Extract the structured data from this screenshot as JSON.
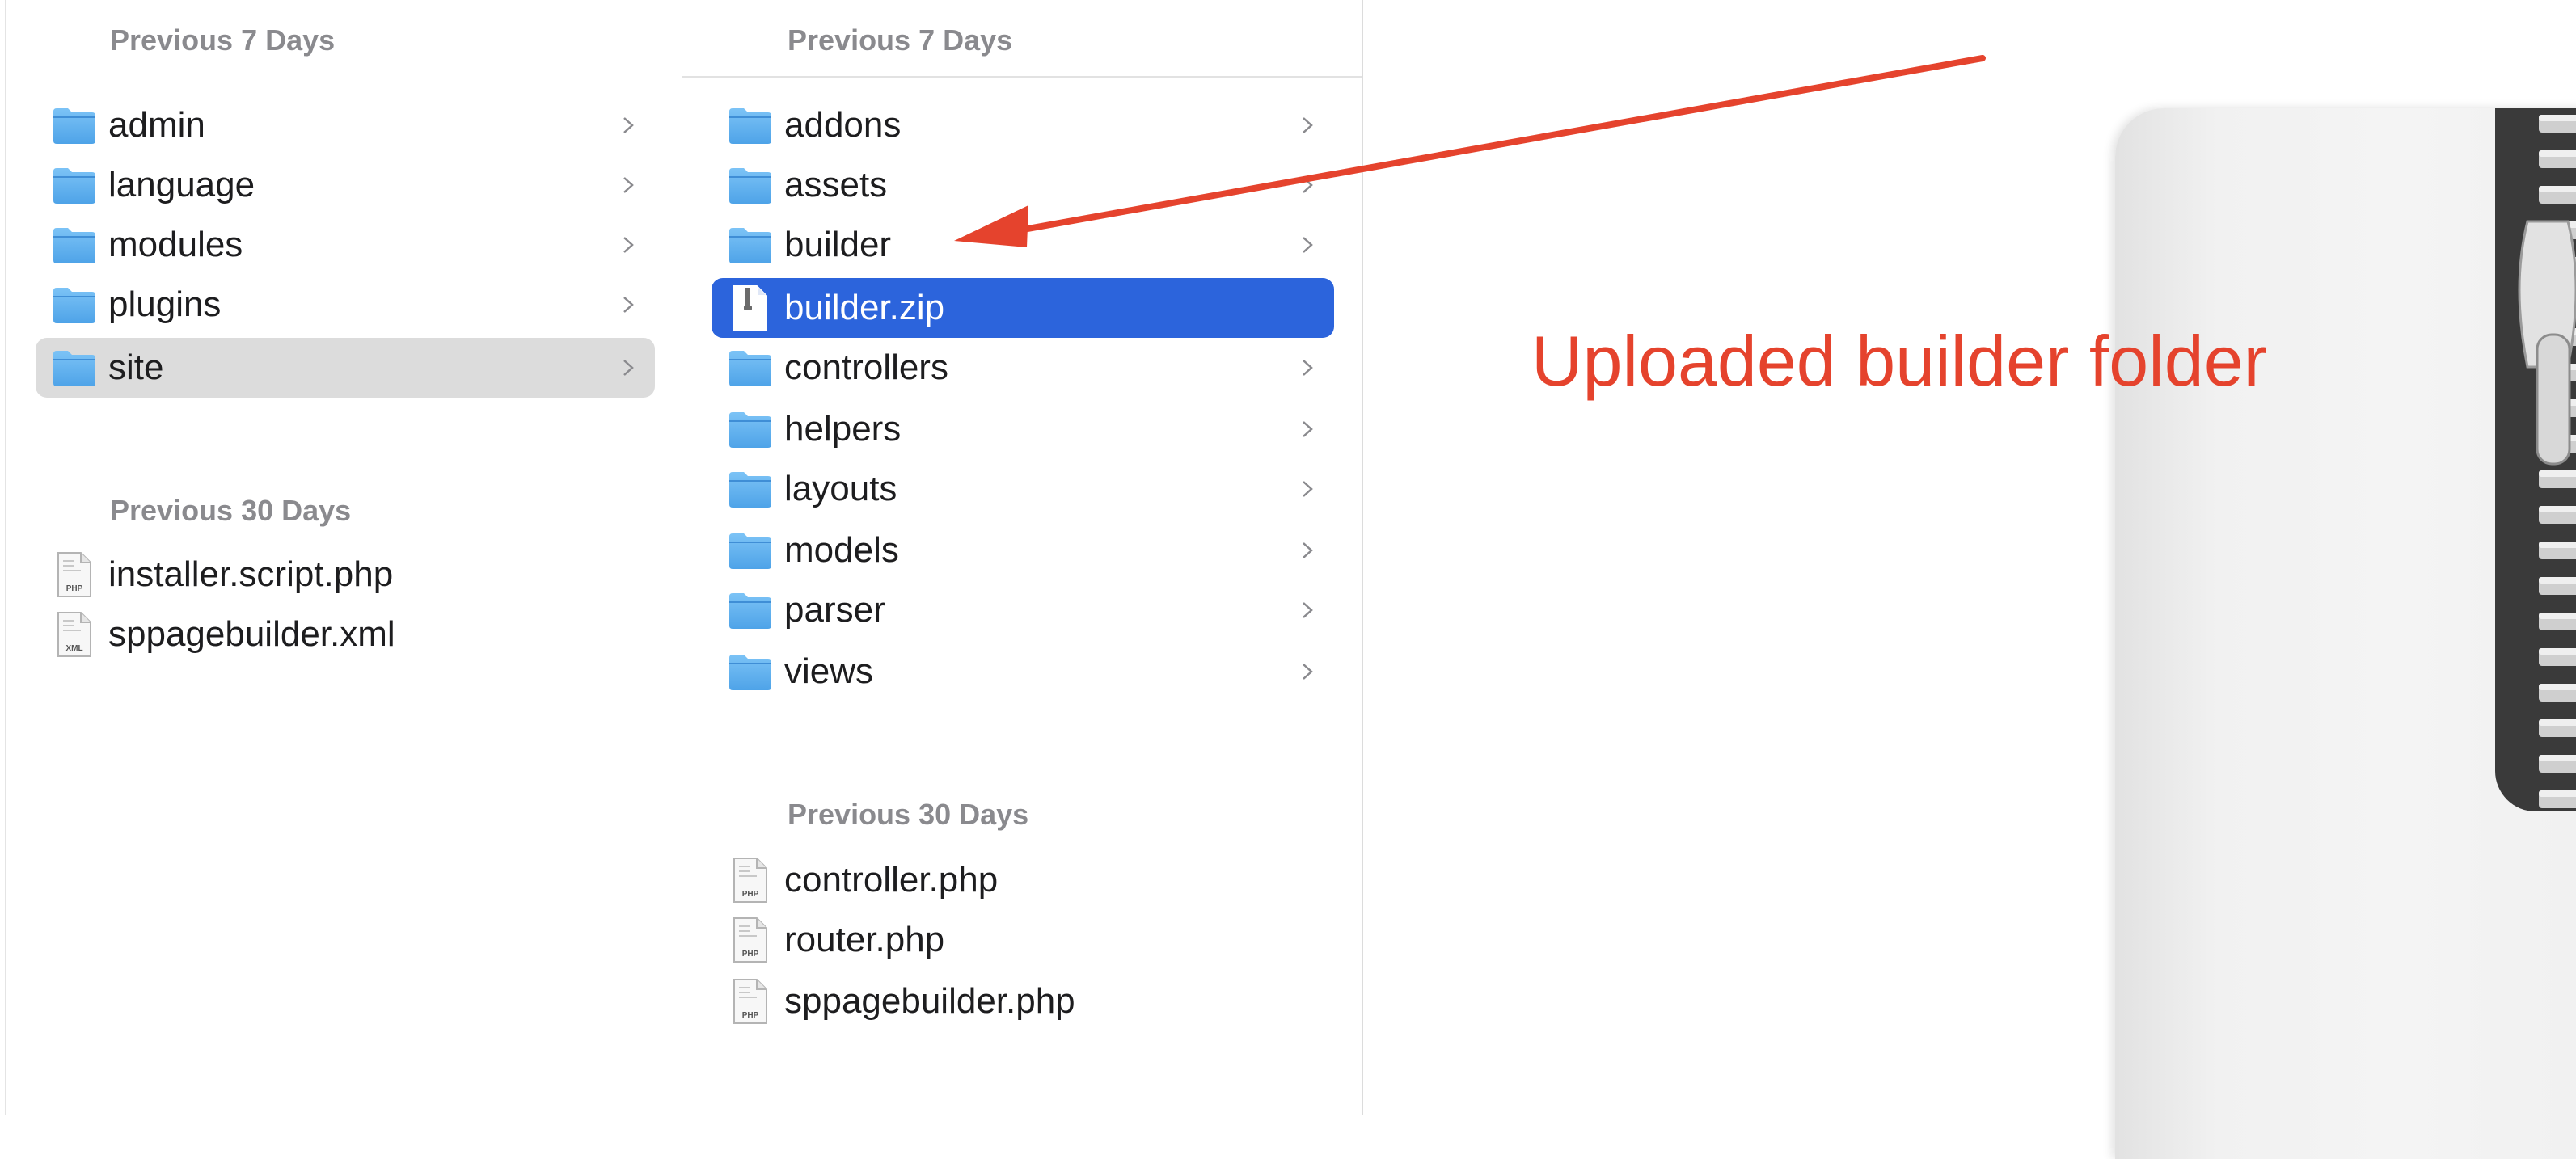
{
  "col1": {
    "section_recent": "Previous 7 Days",
    "items": [
      {
        "label": "admin"
      },
      {
        "label": "language"
      },
      {
        "label": "modules"
      },
      {
        "label": "plugins"
      },
      {
        "label": "site",
        "selected": true
      }
    ],
    "section_older": "Previous 30 Days",
    "files": [
      {
        "label": "installer.script.php",
        "badge": "PHP"
      },
      {
        "label": "sppagebuilder.xml",
        "badge": "XML"
      }
    ]
  },
  "col2": {
    "section_recent": "Previous 7 Days",
    "items": [
      {
        "label": "addons"
      },
      {
        "label": "assets"
      },
      {
        "label": "builder"
      },
      {
        "label": "builder.zip",
        "selected": true
      },
      {
        "label": "controllers"
      },
      {
        "label": "helpers"
      },
      {
        "label": "layouts"
      },
      {
        "label": "models"
      },
      {
        "label": "parser"
      },
      {
        "label": "views"
      }
    ],
    "section_older": "Previous 30 Days",
    "files": [
      {
        "label": "controller.php",
        "badge": "PHP"
      },
      {
        "label": "router.php",
        "badge": "PHP"
      },
      {
        "label": "sppagebuilder.php",
        "badge": "PHP"
      }
    ]
  },
  "annotation": {
    "text": "Uploaded builder folder",
    "color": "#e5432d"
  },
  "colors": {
    "selection_blue": "#2c64dc",
    "selection_grey": "#dcdcdc",
    "folder_blue": "#5aaef0"
  }
}
